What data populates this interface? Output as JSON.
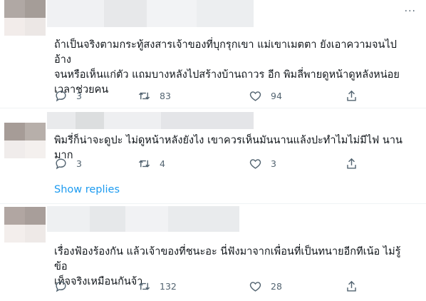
{
  "more_label": "···",
  "replies": [
    {
      "text": "ถ้าเป็นจริงตามกระทู้สงสารเจ้าของที่บุกรุกเขา แม่เขาเมตตา ยังเอาความจนไปอ้าง\nจนหรือเห็นแก่ตัว แถมบางหลังไปสร้างบ้านถาวร อีก พิมลี่พายดูหน้าดูหลังหน่อย\nเวลาช่วยคน",
      "reply_count": "3",
      "retweet_count": "83",
      "like_count": "94",
      "avatar_colors": [
        "#b0a8a4",
        "#a59d98",
        "#f2ecea",
        "#ece7e5"
      ],
      "name_colors": [
        "#f0f1f3",
        "#e7e8ea",
        "#f2f3f5",
        "#eceef0"
      ]
    },
    {
      "text": "พิมรี่ก็น่าจะดูปะ ไม่ดูหน้าหลังยังไง เขาควรเห็นมันนานแล้งปะทำไมไม่มีไฟ นานมาก",
      "reply_count": "3",
      "retweet_count": "4",
      "like_count": "3",
      "avatar_colors": [
        "#a69c97",
        "#b7afaa",
        "#f0eceb",
        "#f4f0ee"
      ],
      "name_colors": [
        "#e9eaec",
        "#dcdedf",
        "#eeeff1",
        "#e4e5e8"
      ]
    },
    {
      "text": "เรื่องฟ้องร้องกัน แล้วเจ้าของที่ชนะอะ นี่ฟังมาจากเพื่อนที่เป็นทนายอีกทีเน้อ ไม่รู้ข้อ\nเท็จจริงเหมือนกันจ้า",
      "reply_count": "",
      "retweet_count": "132",
      "like_count": "28",
      "avatar_colors": [
        "#b1a6a2",
        "#a89e9a",
        "#f3eeec",
        "#eee9e7"
      ],
      "name_colors": [
        "#eef0f2",
        "#e6e8ea",
        "#f1f2f4",
        "#e9ebed"
      ]
    }
  ],
  "show_replies": "Show replies",
  "colors": {
    "icon": "#536471",
    "link": "#1d9bf0",
    "text": "#0f1419",
    "divider": "#eff3f4"
  }
}
